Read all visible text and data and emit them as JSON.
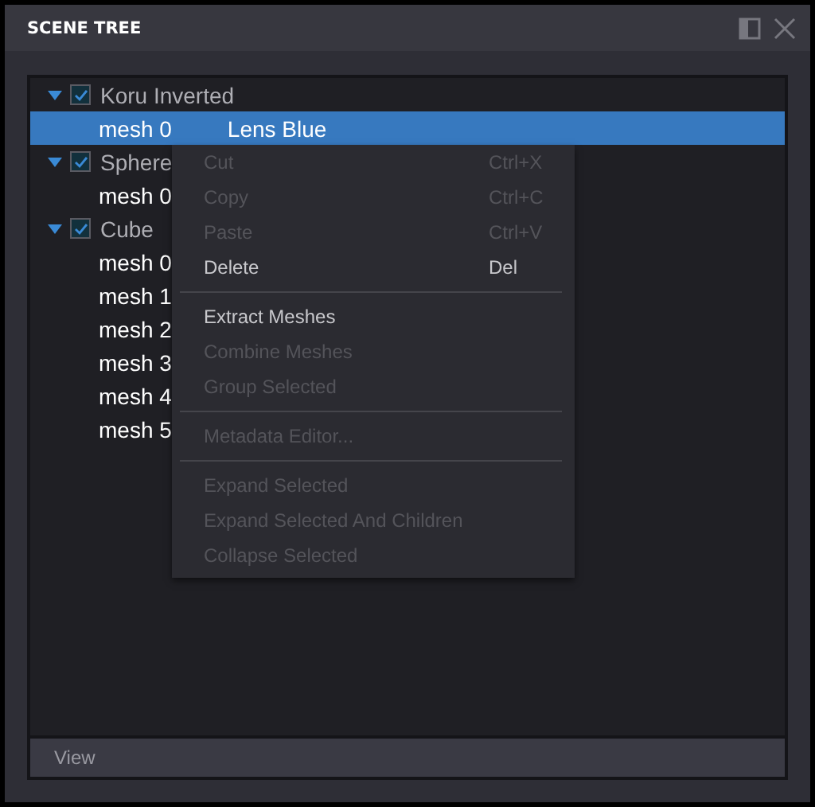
{
  "window": {
    "title": "SCENE TREE"
  },
  "tree": [
    {
      "label": "Koru Inverted",
      "checked": true,
      "expanded": true,
      "selected": false,
      "children": [
        {
          "label": "mesh 0",
          "material": "Lens Blue",
          "selected": true
        }
      ]
    },
    {
      "label": "Sphere",
      "checked": true,
      "expanded": true,
      "selected": false,
      "children": [
        {
          "label": "mesh 0",
          "selected": false
        }
      ]
    },
    {
      "label": "Cube",
      "checked": true,
      "expanded": true,
      "selected": false,
      "children": [
        {
          "label": "mesh 0",
          "selected": false
        },
        {
          "label": "mesh 1",
          "selected": false
        },
        {
          "label": "mesh 2",
          "selected": false
        },
        {
          "label": "mesh 3",
          "selected": false
        },
        {
          "label": "mesh 4",
          "selected": false
        },
        {
          "label": "mesh 5",
          "selected": false
        }
      ]
    }
  ],
  "context_menu": [
    {
      "kind": "item",
      "label": "Cut",
      "shortcut": "Ctrl+X",
      "disabled": true
    },
    {
      "kind": "item",
      "label": "Copy",
      "shortcut": "Ctrl+C",
      "disabled": true
    },
    {
      "kind": "item",
      "label": "Paste",
      "shortcut": "Ctrl+V",
      "disabled": true
    },
    {
      "kind": "item",
      "label": "Delete",
      "shortcut": "Del",
      "disabled": false
    },
    {
      "kind": "separator"
    },
    {
      "kind": "item",
      "label": "Extract Meshes",
      "disabled": false
    },
    {
      "kind": "item",
      "label": "Combine Meshes",
      "disabled": true
    },
    {
      "kind": "item",
      "label": "Group Selected",
      "disabled": true
    },
    {
      "kind": "separator"
    },
    {
      "kind": "item",
      "label": "Metadata Editor...",
      "disabled": true
    },
    {
      "kind": "separator"
    },
    {
      "kind": "item",
      "label": "Expand Selected",
      "disabled": true
    },
    {
      "kind": "item",
      "label": "Expand Selected And Children",
      "disabled": true
    },
    {
      "kind": "item",
      "label": "Collapse Selected",
      "disabled": true
    }
  ],
  "footer": {
    "label": "View"
  }
}
